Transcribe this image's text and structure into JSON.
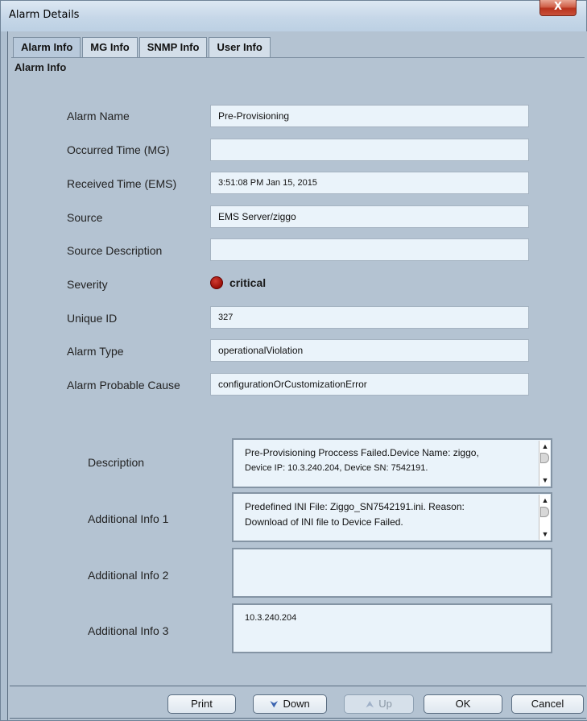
{
  "window": {
    "title": "Alarm Details",
    "close_label": "X"
  },
  "tabs": [
    {
      "label": "Alarm Info"
    },
    {
      "label": "MG Info"
    },
    {
      "label": "SNMP Info"
    },
    {
      "label": "User Info"
    }
  ],
  "section_title": "Alarm Info",
  "fields": {
    "alarm_name": {
      "label": "Alarm Name",
      "value": "Pre-Provisioning"
    },
    "occurred_time": {
      "label": "Occurred Time (MG)",
      "value": ""
    },
    "received_time": {
      "label": "Received Time (EMS)",
      "value": "3:51:08 PM Jan 15, 2015"
    },
    "source": {
      "label": "Source",
      "value": "EMS Server/ziggo"
    },
    "source_description": {
      "label": "Source Description",
      "value": ""
    },
    "severity": {
      "label": "Severity",
      "value": "critical",
      "color": "#9a1008"
    },
    "unique_id": {
      "label": "Unique ID",
      "value": "327"
    },
    "alarm_type": {
      "label": "Alarm Type",
      "value": "operationalViolation"
    },
    "probable_cause": {
      "label": "Alarm Probable Cause",
      "value": "configurationOrCustomizationError"
    }
  },
  "text_areas": {
    "description": {
      "label": "Description",
      "line1": "Pre-Provisioning Proccess Failed.Device Name: ziggo,",
      "line2": "Device IP: 10.3.240.204, Device SN: 7542191."
    },
    "additional_1": {
      "label": "Additional Info 1",
      "line1": "Predefined INI File: Ziggo_SN7542191.ini. Reason:",
      "line2": "Download of INI file to Device Failed."
    },
    "additional_2": {
      "label": "Additional Info 2",
      "line1": "",
      "line2": ""
    },
    "additional_3": {
      "label": "Additional Info 3",
      "line1": "10.3.240.204",
      "line2": ""
    }
  },
  "buttons": {
    "print": "Print",
    "down": "Down",
    "up": "Up",
    "ok": "OK",
    "cancel": "Cancel"
  },
  "icons": {
    "close": "close-icon",
    "down": "double-chevron-down-icon",
    "up": "double-chevron-up-icon",
    "severity": "red-dot-icon",
    "scroll_up": "arrow-up-icon",
    "scroll_down": "arrow-down-icon"
  }
}
